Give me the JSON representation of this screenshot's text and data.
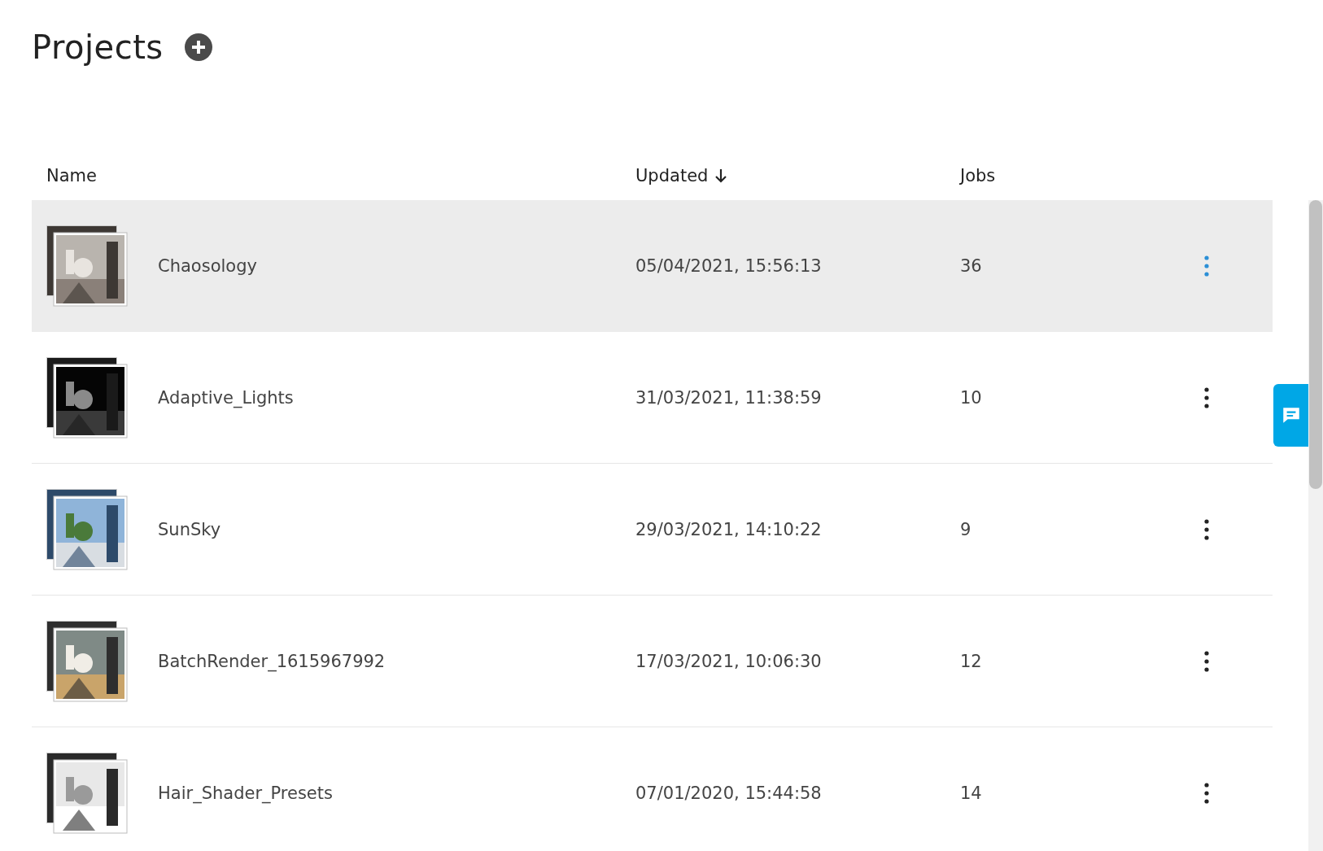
{
  "page": {
    "title": "Projects"
  },
  "table": {
    "columns": [
      {
        "label": "Name",
        "sorted": false
      },
      {
        "label": "Updated",
        "sorted": true
      },
      {
        "label": "Jobs",
        "sorted": false
      }
    ],
    "rows": [
      {
        "name": "Chaosology",
        "updated": "05/04/2021, 15:56:13",
        "jobs": "36",
        "hovered": true
      },
      {
        "name": "Adaptive_Lights",
        "updated": "31/03/2021, 11:38:59",
        "jobs": "10",
        "hovered": false
      },
      {
        "name": "SunSky",
        "updated": "29/03/2021, 14:10:22",
        "jobs": "9",
        "hovered": false
      },
      {
        "name": "BatchRender_1615967992",
        "updated": "17/03/2021, 10:06:30",
        "jobs": "12",
        "hovered": false
      },
      {
        "name": "Hair_Shader_Presets",
        "updated": "07/01/2020, 15:44:58",
        "jobs": "14",
        "hovered": false
      }
    ]
  }
}
